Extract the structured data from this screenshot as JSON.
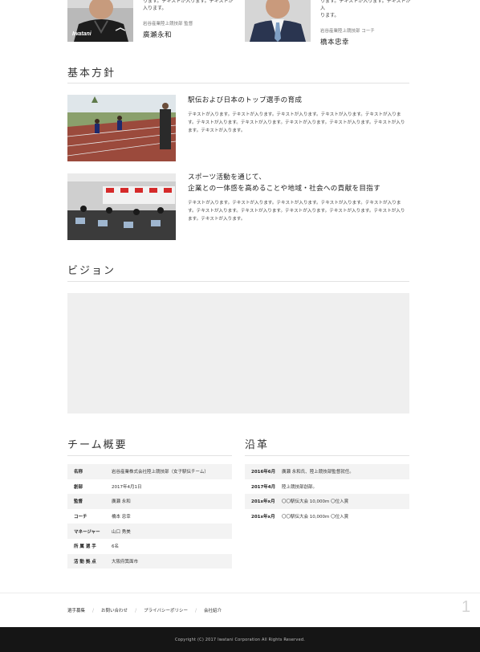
{
  "staff": [
    {
      "snippet": "ります。テキストが入ります。テキストが\n入ります。",
      "role": "岩谷産業陸上競技部 監督",
      "name": "廣瀬永和",
      "photo_text": "Iwatani"
    },
    {
      "snippet": "ります。テキストが入ります。テキストが入\nります。",
      "role": "岩谷産業陸上競技部 コーチ",
      "name": "橋本忠幸"
    }
  ],
  "policy": {
    "title": "基本方針",
    "items": [
      {
        "heading": "駅伝および日本のトップ選手の育成",
        "body": "テキストが入ります。テキストが入ります。テキストが入ります。テキストが入ります。テキストが入ります。テキストが入ります。テキストが入ります。テキストが入ります。テキストが入ります。テキストが入ります。テキストが入ります。"
      },
      {
        "heading": "スポーツ活動を通じて、\n企業との一体感を高めることや地域・社会への貢献を目指す",
        "body": "テキストが入ります。テキストが入ります。テキストが入ります。テキストが入ります。テキストが入ります。テキストが入ります。テキストが入ります。テキストが入ります。テキストが入ります。テキストが入ります。テキストが入ります。"
      }
    ]
  },
  "vision": {
    "title": "ビジョン"
  },
  "team": {
    "title": "チーム概要",
    "rows": [
      {
        "label": "名称",
        "value": "岩谷産業株式会社陸上競技部（女子駅伝チーム）"
      },
      {
        "label": "創部",
        "value": "2017年4月1日"
      },
      {
        "label": "監督",
        "value": "廣瀬 永和"
      },
      {
        "label": "コーチ",
        "value": "橋本 忠幸"
      },
      {
        "label": "マネージャー",
        "value": "山口 秀美"
      },
      {
        "label": "所 属 選 手",
        "value": "6名"
      },
      {
        "label": "活 動 拠 点",
        "value": "大阪府箕面市"
      }
    ]
  },
  "history": {
    "title": "沿革",
    "rows": [
      {
        "label": "2016年6月",
        "value": "廣瀬 永和氏、陸上競技部監督就任。"
      },
      {
        "label": "2017年4月",
        "value": "陸上競技部創部。"
      },
      {
        "label": "201x年x月",
        "value": "〇〇駅伝大会 10,000m 〇位入賞"
      },
      {
        "label": "201x年x月",
        "value": "〇〇駅伝大会 10,000m 〇位入賞"
      }
    ]
  },
  "footer": {
    "nav": [
      "選手募集",
      "お問い合わせ",
      "プライバシーポリシー",
      "会社紹介"
    ],
    "page_number": "1",
    "copyright": "Copyright (C) 2017 Iwatani Corporation All Rights Reserved."
  },
  "colors": {
    "rule": "#e2e2e2",
    "placeholder": "#efefef",
    "footer_bg": "#151515"
  }
}
